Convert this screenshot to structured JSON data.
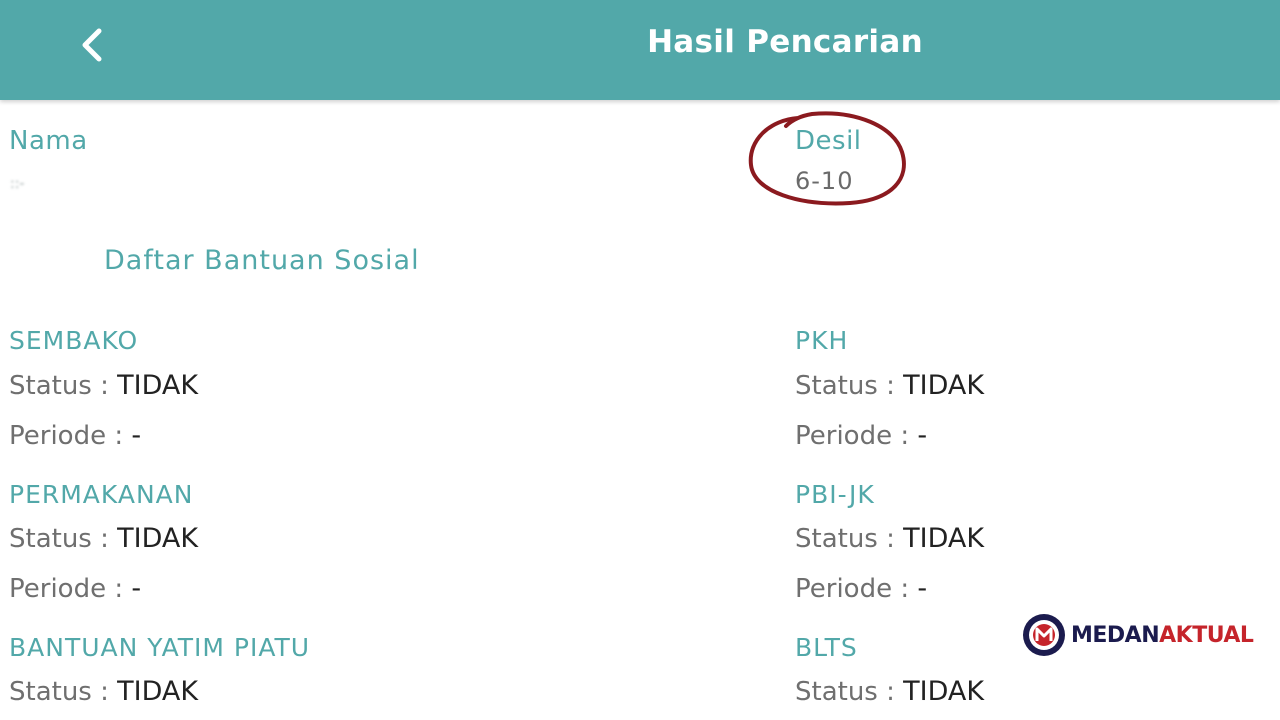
{
  "header": {
    "title": "Hasil Pencarian",
    "back_icon": "chevron-left-icon"
  },
  "person": {
    "name_label": "Nama",
    "name_value": "::-",
    "desil_label": "Desil",
    "desil_value": "6-10"
  },
  "section": {
    "title": "Daftar Bantuan Sosial"
  },
  "programs": [
    {
      "name": "SEMBAKO",
      "status_label": "Status : ",
      "status_value": "TIDAK",
      "periode_label": "Periode : ",
      "periode_value": "-"
    },
    {
      "name": "PKH",
      "status_label": "Status : ",
      "status_value": "TIDAK",
      "periode_label": "Periode : ",
      "periode_value": "-"
    },
    {
      "name": "PERMAKANAN",
      "status_label": "Status : ",
      "status_value": "TIDAK",
      "periode_label": "Periode : ",
      "periode_value": "-"
    },
    {
      "name": "PBI-JK",
      "status_label": "Status : ",
      "status_value": "TIDAK",
      "periode_label": "Periode : ",
      "periode_value": "-"
    },
    {
      "name": "BANTUAN YATIM PIATU",
      "status_label": "Status : ",
      "status_value": "TIDAK"
    },
    {
      "name": "BLTS",
      "status_label": "Status : ",
      "status_value": "TIDAK"
    }
  ],
  "watermark": {
    "part1": "MEDAN",
    "part2": "AKTUAL",
    "color_primary": "#1b1b4e",
    "color_accent": "#c5242b"
  },
  "colors": {
    "header_bg": "#52a8a9",
    "teal_text": "#52a8a9",
    "highlight_circle": "#8b1a1f"
  }
}
